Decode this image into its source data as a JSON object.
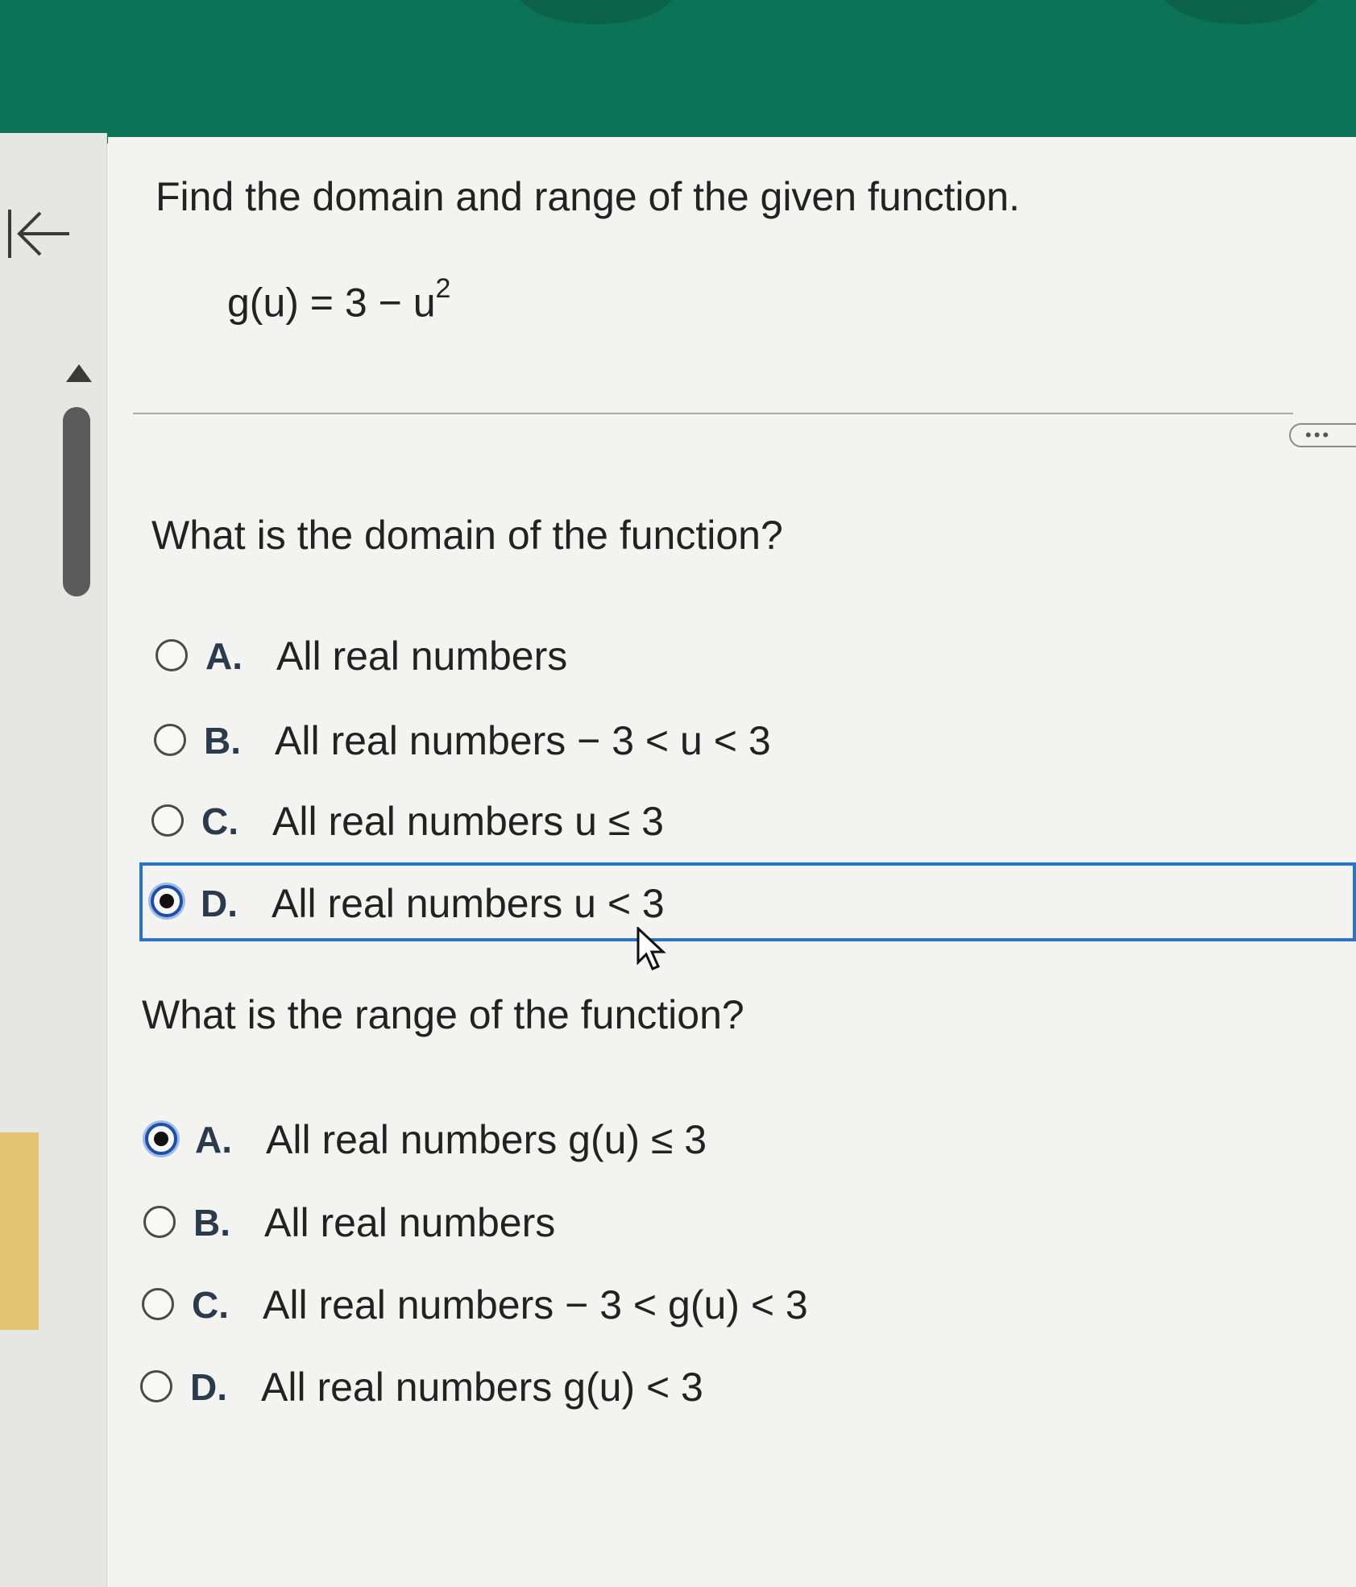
{
  "colors": {
    "banner": "#0d7356",
    "selection_border": "#2a73c7",
    "radio_checked": "#1f4fa5",
    "side_marker": "#e3c473"
  },
  "nav": {
    "collapse_icon": "arrow-left-to-bar-icon",
    "collapse_glyph": "I←",
    "scroll_up_icon": "triangle-up-icon"
  },
  "question": {
    "title": "Find the domain and range of the given function.",
    "function_base": "g(u) = 3 − u",
    "function_exponent": "2",
    "more_label": "•••"
  },
  "domain": {
    "prompt": "What is the domain of the function?",
    "selected": "D",
    "choices": [
      {
        "letter": "A.",
        "text": "All real numbers"
      },
      {
        "letter": "B.",
        "text": "All real numbers  − 3 < u < 3"
      },
      {
        "letter": "C.",
        "text": "All real numbers u ≤ 3"
      },
      {
        "letter": "D.",
        "text": "All real numbers u < 3"
      }
    ]
  },
  "range": {
    "prompt": "What is the range of the function?",
    "selected": "A",
    "choices": [
      {
        "letter": "A.",
        "text": "All real numbers g(u) ≤ 3"
      },
      {
        "letter": "B.",
        "text": "All real numbers"
      },
      {
        "letter": "C.",
        "text": "All real numbers  − 3 < g(u) < 3"
      },
      {
        "letter": "D.",
        "text": "All real numbers g(u) < 3"
      }
    ]
  }
}
